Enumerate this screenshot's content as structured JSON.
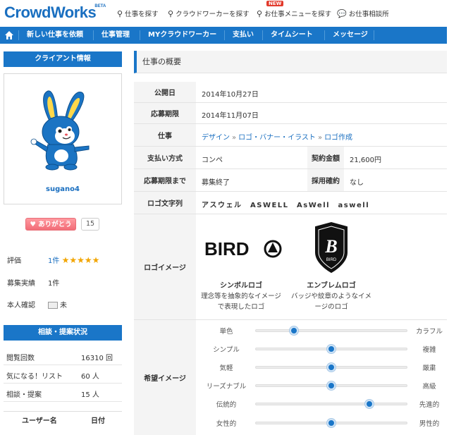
{
  "header": {
    "logo": "CrowdWorks",
    "beta": "BETA",
    "nav": [
      {
        "label": "仕事を探す",
        "icon": "search-icon"
      },
      {
        "label": "クラウドワーカーを探す",
        "icon": "search-icon"
      },
      {
        "label": "お仕事メニューを探す",
        "icon": "search-icon",
        "badge": "NEW"
      },
      {
        "label": "お仕事相談所",
        "icon": "chat-icon"
      }
    ]
  },
  "menu": [
    "新しい仕事を依頼",
    "仕事管理",
    "MYクラウドワーカー",
    "支払い",
    "タイムシート",
    "メッセージ"
  ],
  "client": {
    "heading": "クライアント情報",
    "name": "sugano4",
    "thanks_label": "ありがとう",
    "thanks_count": "15",
    "rating_label": "評価",
    "rating_count": "1件",
    "rating_stars": 5,
    "stars_text": "★★★★★",
    "record_label": "募集実績",
    "record_value": "1件",
    "verify_label": "本人確認",
    "verify_value": "未"
  },
  "status": {
    "heading": "相談・提案状況",
    "rows": [
      {
        "label": "閲覧回数",
        "value": "16310 回"
      },
      {
        "label": "気になる！リスト",
        "value": "60 人"
      },
      {
        "label": "相談・提案",
        "value": "15 人"
      }
    ],
    "col_user": "ユーザー名",
    "col_date": "日付"
  },
  "overview": {
    "title": "仕事の概要",
    "published_label": "公開日",
    "published": "2014年10月27日",
    "deadline_label": "応募期限",
    "deadline": "2014年11月07日",
    "job_label": "仕事",
    "job_crumbs": [
      "デザイン",
      "ロゴ・バナー・イラスト",
      "ロゴ作成"
    ],
    "crumb_sep": "»",
    "payment_label": "支払い方式",
    "payment": "コンペ",
    "amount_label": "契約金額",
    "amount": "21,600円",
    "until_label": "応募期限まで",
    "until": "募集終了",
    "hire_label": "採用確約",
    "hire": "なし",
    "logo_text_label": "ロゴ文字列",
    "logo_text": "アスウェル　ASWELL　AsWell　aswell",
    "logo_image_label": "ロゴイメージ",
    "symbol_caption": "シンボルロゴ",
    "symbol_desc": "理念等を抽象的なイメージで表現したロゴ",
    "symbol_wordmark": "BIRD",
    "emblem_caption": "エンブレムロゴ",
    "emblem_desc": "バッジや紋章のようなイメージのロゴ",
    "emblem_word": "BIRD",
    "emblem_letter": "B",
    "image_label": "希望イメージ"
  },
  "sliders": [
    {
      "left": "単色",
      "right": "カラフル",
      "value": 0.25
    },
    {
      "left": "シンプル",
      "right": "複雑",
      "value": 0.5
    },
    {
      "left": "気軽",
      "right": "厳粛",
      "value": 0.5
    },
    {
      "left": "リーズナブル",
      "right": "高級",
      "value": 0.5
    },
    {
      "left": "伝統的",
      "right": "先進的",
      "value": 0.75
    },
    {
      "left": "女性的",
      "right": "男性的",
      "value": 0.5
    }
  ]
}
